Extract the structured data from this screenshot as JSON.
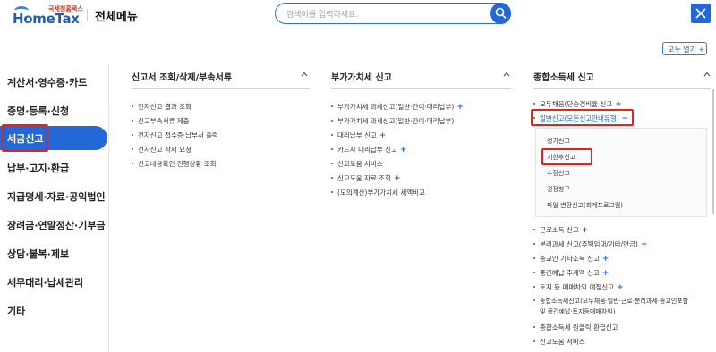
{
  "header": {
    "logo_sub": "국세청홈택스",
    "logo_main": "HomeTax",
    "title": "전체메뉴",
    "search_placeholder": "검색어를 입력하세요."
  },
  "view_all_label": "모두 열기 +",
  "left_nav": [
    {
      "label": "계산서·영수증·카드"
    },
    {
      "label": "증명·등록·신청"
    },
    {
      "label": "세금신고",
      "active": true
    },
    {
      "label": "납부·고지·환급"
    },
    {
      "label": "지급명세·자료·공익법인"
    },
    {
      "label": "장려금·연말정산·기부금"
    },
    {
      "label": "상담·불복·제보"
    },
    {
      "label": "세무대리·납세관리"
    },
    {
      "label": "기타"
    }
  ],
  "columns": [
    {
      "title": "신고서 조회/삭제/부속서류",
      "items": [
        {
          "label": "전자신고 결과 조회",
          "plus": false
        },
        {
          "label": "신고부속서류 제출",
          "plus": false
        },
        {
          "label": "전자신고 접수증·납부서 출력",
          "plus": false
        },
        {
          "label": "전자신고 삭제 요청",
          "plus": false
        },
        {
          "label": "신고내용확인 진행상황 조회",
          "plus": false
        }
      ]
    },
    {
      "title": "부가가치세 신고",
      "items": [
        {
          "label": "부가가치세 과세신고(일반·간이·대리납부)",
          "plus": true
        },
        {
          "label": "부가가치세 과세신고(일반·간이·대리납부)",
          "plus": false
        },
        {
          "label": "대리납부 신고",
          "plus": true
        },
        {
          "label": "카드사 대리납부 신고",
          "plus": true
        },
        {
          "label": "신고도움 서비스",
          "plus": false
        },
        {
          "label": "신고도움 자료 조회",
          "plus": true
        },
        {
          "label": "(모의계산)부가가치세 세액비교",
          "plus": false
        }
      ]
    },
    {
      "title": "종합소득세 신고",
      "top_items": [
        {
          "label": "모두채움(단순경비율 신고",
          "plus": true
        },
        {
          "label": "일반신고(모든신고안내유형)",
          "minus": true
        }
      ],
      "sub_items": [
        {
          "label": "정기신고"
        },
        {
          "label": "기한후신고"
        },
        {
          "label": "수정신고"
        },
        {
          "label": "경정청구"
        },
        {
          "label": "파일 변환신고(회계프로그램)"
        }
      ],
      "items": [
        {
          "label": "근로소득 신고",
          "plus": true
        },
        {
          "label": "분리과세 신고(주택임대/기타/연금)",
          "plus": true
        },
        {
          "label": "종교인 기타소득 신고",
          "plus": true
        },
        {
          "label": "중간예납 추계액 신고",
          "plus": true
        },
        {
          "label": "토지 등 매매차익 예정신고",
          "plus": true
        },
        {
          "label": "종합소득세신고(모두채움·일반·근로·분리과세·종교인포함",
          "plus": false
        },
        {
          "label": "및 중간예납·토지등매매차익)",
          "plus": false,
          "cont": true
        },
        {
          "label": "종합소득세 원클릭 환급신고",
          "plus": false
        },
        {
          "label": "신고도움 서비스",
          "plus": false
        }
      ]
    }
  ]
}
